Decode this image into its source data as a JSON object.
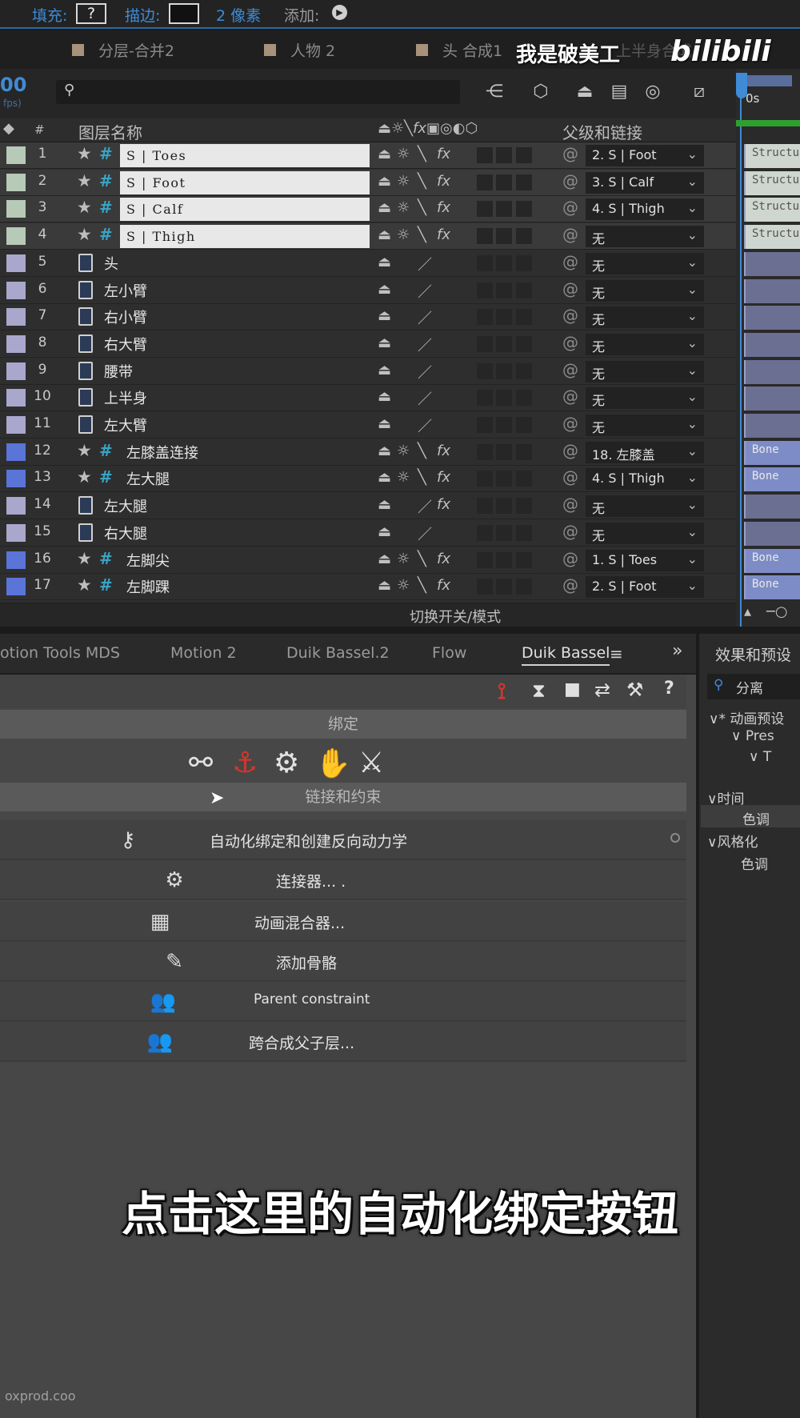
{
  "toolbar": {
    "fill_label": "填充:",
    "fill_value": "?",
    "stroke_label": "描边:",
    "stroke_width": "2 像素",
    "add_label": "添加:"
  },
  "comp_tabs": [
    "分层-合并2",
    "人物 2",
    "头 合成1",
    "上半身合成"
  ],
  "timecode": "00",
  "timecode_sub": "fps)",
  "columns": {
    "name": "图层名称",
    "parent": "父级和链接",
    "hash": "#",
    "time_start": "0s"
  },
  "layers": [
    {
      "num": "1",
      "name": "S | Toes",
      "type": "shape",
      "parent": "2. S | Foot",
      "label_color": "#b7c9b7",
      "fx": true,
      "selected": true,
      "bar": "Structu"
    },
    {
      "num": "2",
      "name": "S | Foot",
      "type": "shape",
      "parent": "3. S | Calf",
      "label_color": "#b7c9b7",
      "fx": true,
      "selected": true,
      "bar": "Structu"
    },
    {
      "num": "3",
      "name": "S | Calf",
      "type": "shape",
      "parent": "4. S | Thigh",
      "label_color": "#b7c9b7",
      "fx": true,
      "selected": true,
      "bar": "Structu"
    },
    {
      "num": "4",
      "name": "S | Thigh",
      "type": "shape",
      "parent": "无",
      "label_color": "#b7c9b7",
      "fx": true,
      "selected": true,
      "bar": "Structu"
    },
    {
      "num": "5",
      "name": "头",
      "type": "file",
      "parent": "无",
      "label_color": "#a9a7cc",
      "fx": false,
      "bar": ""
    },
    {
      "num": "6",
      "name": "左小臂",
      "type": "file",
      "parent": "无",
      "label_color": "#a9a7cc",
      "fx": false,
      "bar": ""
    },
    {
      "num": "7",
      "name": "右小臂",
      "type": "file",
      "parent": "无",
      "label_color": "#a9a7cc",
      "fx": false,
      "bar": ""
    },
    {
      "num": "8",
      "name": "右大臂",
      "type": "file",
      "parent": "无",
      "label_color": "#a9a7cc",
      "fx": false,
      "bar": ""
    },
    {
      "num": "9",
      "name": "腰带",
      "type": "file",
      "parent": "无",
      "label_color": "#a9a7cc",
      "fx": false,
      "bar": ""
    },
    {
      "num": "10",
      "name": "上半身",
      "type": "file",
      "parent": "无",
      "label_color": "#a9a7cc",
      "fx": false,
      "bar": ""
    },
    {
      "num": "11",
      "name": "左大臂",
      "type": "file",
      "parent": "无",
      "label_color": "#a9a7cc",
      "fx": false,
      "bar": ""
    },
    {
      "num": "12",
      "name": "左膝盖连接",
      "type": "shape",
      "parent": "18. 左膝盖",
      "label_color": "#5a74d8",
      "fx": true,
      "bar": "Bone"
    },
    {
      "num": "13",
      "name": "左大腿",
      "type": "shape",
      "parent": "4. S | Thigh",
      "label_color": "#5a74d8",
      "fx": true,
      "bar": "Bone"
    },
    {
      "num": "14",
      "name": "左大腿",
      "type": "file",
      "parent": "无",
      "label_color": "#a9a7cc",
      "fx": true,
      "bar": ""
    },
    {
      "num": "15",
      "name": "右大腿",
      "type": "file",
      "parent": "无",
      "label_color": "#a9a7cc",
      "fx": false,
      "bar": ""
    },
    {
      "num": "16",
      "name": "左脚尖",
      "type": "shape",
      "parent": "1. S | Toes",
      "label_color": "#5a74d8",
      "fx": true,
      "bar": "Bone"
    },
    {
      "num": "17",
      "name": "左脚踝",
      "type": "shape",
      "parent": "2. S | Foot",
      "label_color": "#5a74d8",
      "fx": true,
      "bar": "Bone"
    }
  ],
  "switch_bar_label": "切换开关/模式",
  "panel_tabs": [
    "otion Tools MDS",
    "Motion 2",
    "Duik Bassel.2",
    "Flow",
    "Duik Bassel"
  ],
  "panel_more": "»",
  "duik": {
    "section_rigging": "绑定",
    "section_links": "链接和约束",
    "menu": [
      {
        "label": "自动化绑定和创建反向动力学",
        "icon": "auto-rig-icon"
      },
      {
        "label": "连接器... .",
        "icon": "connector-icon"
      },
      {
        "label": "动画混合器...",
        "icon": "animation-blender-icon"
      },
      {
        "label": "添加骨骼",
        "icon": "add-bones-icon"
      },
      {
        "label": "Parent constraint",
        "icon": "parent-constraint-icon"
      },
      {
        "label": "跨合成父子层...",
        "icon": "parent-across-comps-icon"
      }
    ]
  },
  "effects_panel": {
    "title": "效果和预设",
    "search": "分离",
    "tree": [
      "∨* 动画预设",
      "∨ Pres",
      "∨ T",
      "∨时间",
      "色调",
      "∨风格化",
      "色调"
    ]
  },
  "overlay": {
    "watermark": "我是破美工",
    "logo": "bilibili",
    "subtitle": "点击这里的自动化绑定按钮",
    "url_fragment": "oxprod.coo"
  },
  "colors": {
    "accent_blue": "#2b6aa3",
    "duik_red": "#d8352a"
  }
}
